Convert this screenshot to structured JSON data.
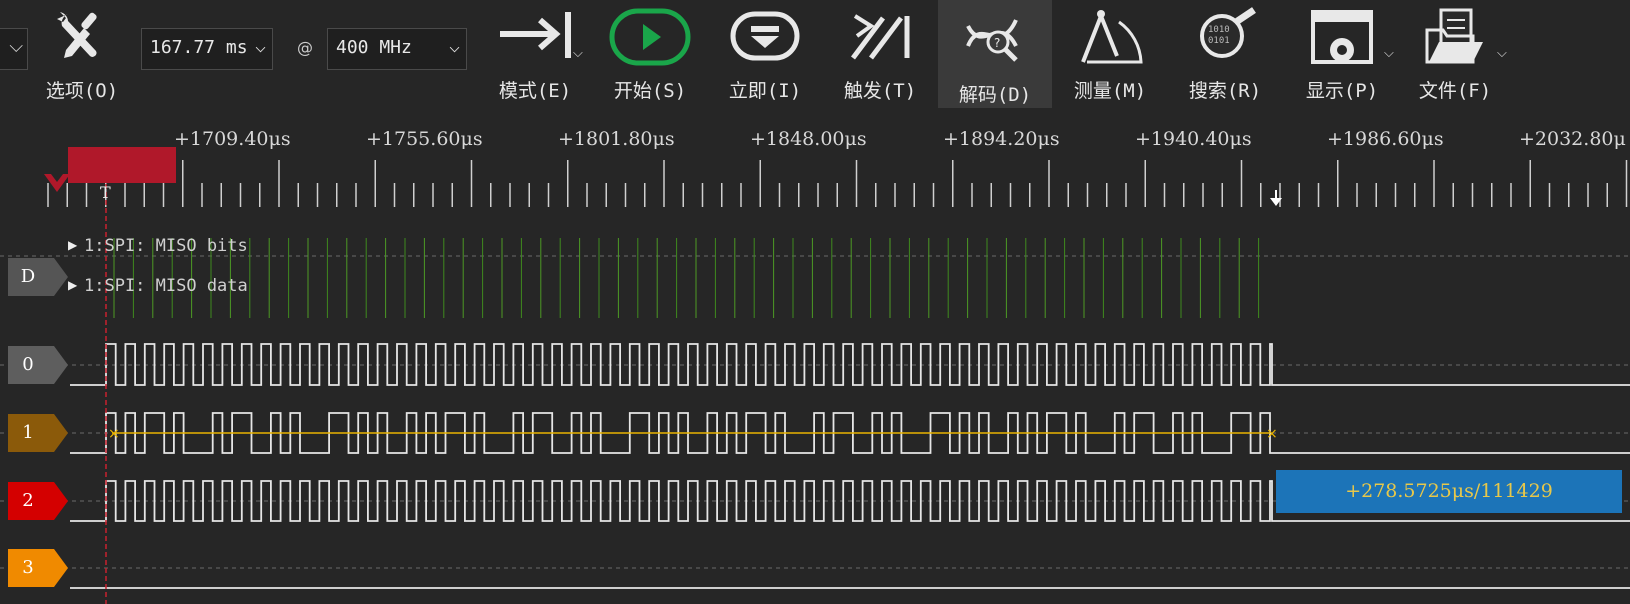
{
  "toolbar": {
    "options_label": "选项(O)",
    "duration_value": "167.77 ms",
    "sample_rate_value": "400 MHz",
    "at_symbol": "@",
    "mode_label": "模式(E)",
    "start_label": "开始(S)",
    "immediate_label": "立即(I)",
    "trigger_label": "触发(T)",
    "decode_label": "解码(D)",
    "measure_label": "测量(M)",
    "search_label": "搜索(R)",
    "display_label": "显示(P)",
    "file_label": "文件(F)"
  },
  "timeline": {
    "labels": [
      "+1709.40μs",
      "+1755.60μs",
      "+1801.80μs",
      "+1848.00μs",
      "+1894.20μs",
      "+1940.40μs",
      "+1986.60μs",
      "+2032.80μ"
    ],
    "trigger_marker": "T"
  },
  "decoders": [
    {
      "label": "1:SPI: MISO bits"
    },
    {
      "label": "1:SPI: MISO data"
    }
  ],
  "channels": [
    {
      "label": "D",
      "color": "#555555"
    },
    {
      "label": "0",
      "color": "#5e5e5e"
    },
    {
      "label": "1",
      "color": "#8b5a0a"
    },
    {
      "label": "2",
      "color": "#d40000"
    },
    {
      "label": "3",
      "color": "#f08a00"
    }
  ],
  "measurement": {
    "text": "+278.5725μs/111429",
    "box_color": "#1c74b8"
  },
  "colors": {
    "background": "#262626",
    "start_green": "#1aa64a",
    "trigger_red": "#b0182a",
    "cursor_yellow": "#e8b400",
    "decode_green": "#3f8a1e"
  },
  "icons": {
    "options": "wrench-screwdriver-icon",
    "mode": "arrow-to-bar-icon",
    "start": "play-circle-icon",
    "immediate": "eject-icon",
    "trigger": "trigger-slashes-icon",
    "decode": "dna-magnifier-icon",
    "measure": "compass-ruler-icon",
    "search": "binary-search-icon",
    "display": "window-gear-icon",
    "file": "folder-document-icon"
  }
}
